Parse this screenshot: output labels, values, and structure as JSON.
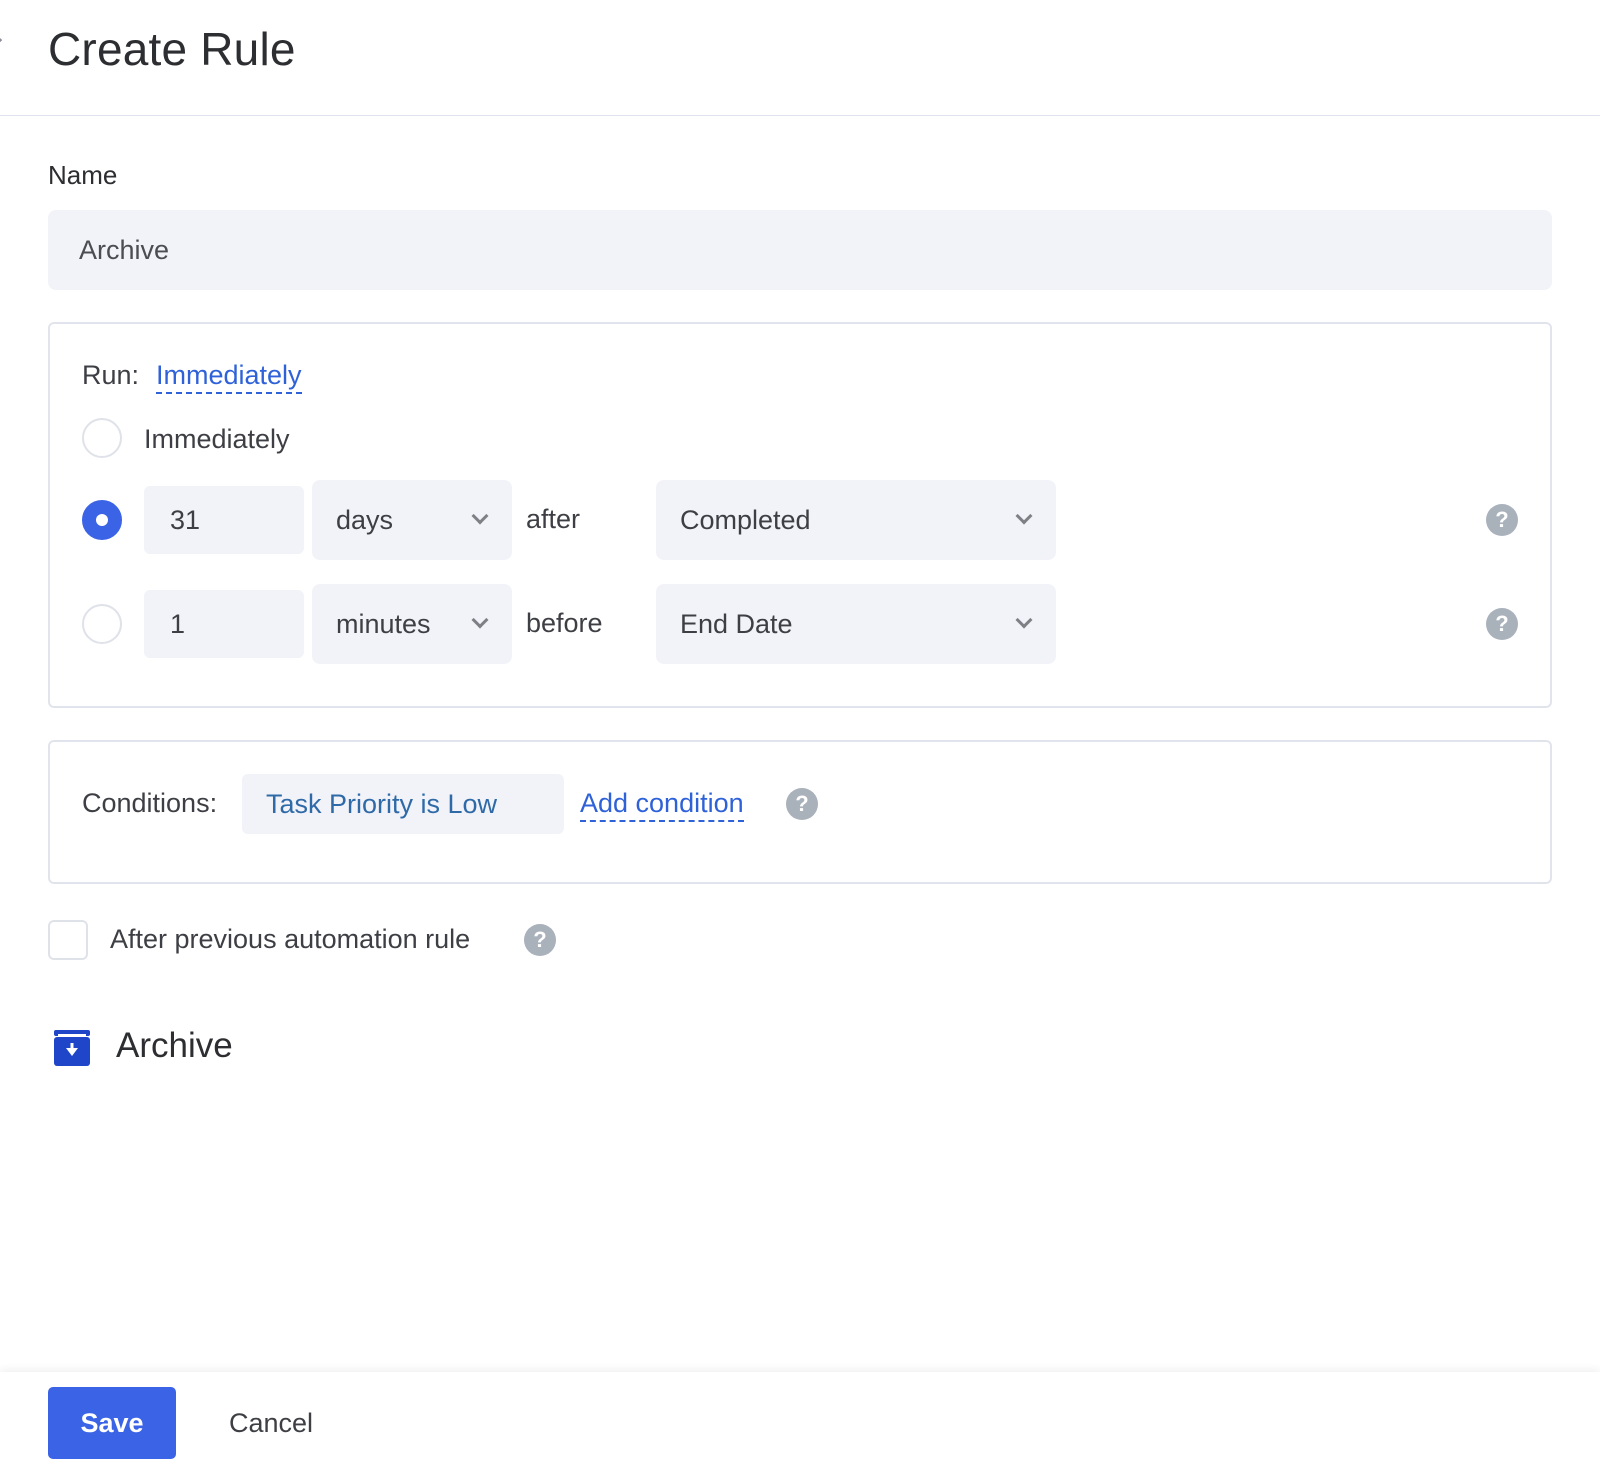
{
  "header": {
    "title": "Create Rule"
  },
  "name_field": {
    "label": "Name",
    "value": "Archive"
  },
  "run": {
    "label": "Run:",
    "current": "Immediately",
    "options": {
      "immediately": {
        "label": "Immediately",
        "selected": false
      },
      "after": {
        "amount": "31",
        "unit": "days",
        "relation": "after",
        "reference": "Completed",
        "selected": true
      },
      "before": {
        "amount": "1",
        "unit": "minutes",
        "relation": "before",
        "reference": "End Date",
        "selected": false
      }
    }
  },
  "conditions": {
    "label": "Conditions:",
    "items": [
      "Task Priority is Low"
    ],
    "add_label": "Add condition"
  },
  "after_previous": {
    "label": "After previous automation rule",
    "checked": false
  },
  "action": {
    "title": "Archive",
    "icon": "archive-icon"
  },
  "footer": {
    "save_label": "Save",
    "cancel_label": "Cancel"
  },
  "help_glyph": "?",
  "colors": {
    "accent": "#3a63e6",
    "link": "#2f62d8",
    "chip_text": "#2f6aa8",
    "action_icon": "#1f45c9",
    "input_bg": "#f2f3f8"
  }
}
